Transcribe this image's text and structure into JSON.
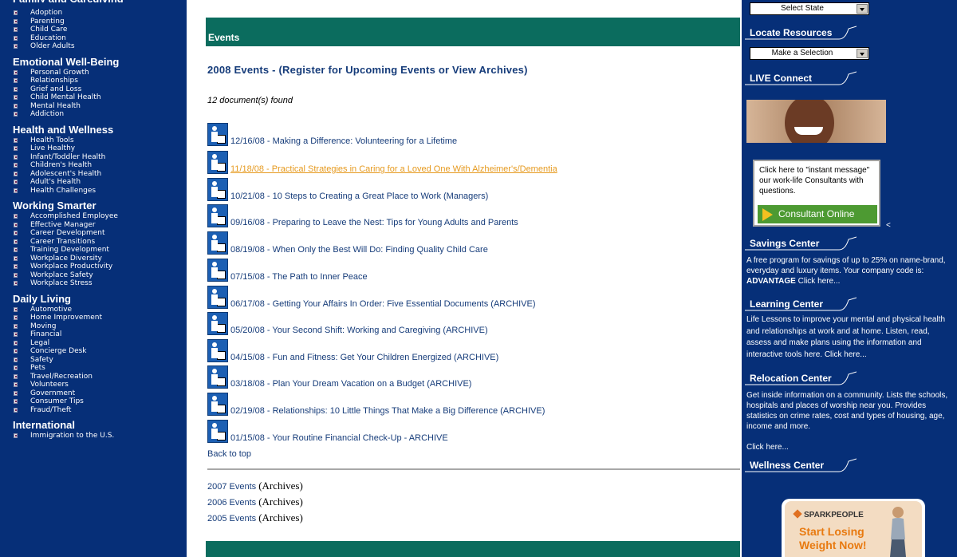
{
  "left_nav": {
    "sections": [
      {
        "title": "Family and Caregiving",
        "items": [
          "Adoption",
          "Parenting",
          "Child Care",
          "Education",
          "Older Adults"
        ]
      },
      {
        "title": "Emotional Well-Being",
        "items": [
          "Personal Growth",
          "Relationships",
          "Grief and Loss",
          "Child Mental Health",
          "Mental Health",
          "Addiction"
        ]
      },
      {
        "title": "Health and Wellness",
        "items": [
          "Health Tools",
          "Live Healthy",
          "Infant/Toddler Health",
          "Children's Health",
          "Adolescent's Health",
          "Adult's Health",
          "Health Challenges"
        ]
      },
      {
        "title": "Working Smarter",
        "items": [
          "Accomplished Employee",
          "Effective Manager",
          "Career Development",
          "Career Transitions",
          "Training Development",
          "Workplace Diversity",
          "Workplace Productivity",
          "Workplace Safety",
          "Workplace Stress"
        ]
      },
      {
        "title": "Daily Living",
        "items": [
          "Automotive",
          "Home Improvement",
          "Moving",
          "Financial",
          "Legal",
          "Concierge Desk",
          "Safety",
          "Pets",
          "Travel/Recreation",
          "Volunteers",
          "Government",
          "Consumer Tips",
          "Fraud/Theft"
        ]
      },
      {
        "title": "International",
        "items": [
          "Immigration to the U.S."
        ]
      }
    ]
  },
  "main": {
    "header": "Events",
    "year_title": "2008 Events - (Register for Upcoming Events or View Archives)",
    "doc_count": "12 document(s) found",
    "events": [
      "12/16/08 - Making a Difference: Volunteering for a Lifetime",
      "11/18/08 - Practical Strategies in Caring for a Loved One With Alzheimer's/Dementia",
      "10/21/08 - 10 Steps to Creating a Great Place to Work (Managers)",
      "09/16/08 - Preparing to Leave the Nest: Tips for Young Adults and Parents",
      "08/19/08 - When Only the Best Will Do: Finding Quality Child Care",
      "07/15/08 - The Path to Inner Peace",
      "06/17/08 - Getting Your Affairs In Order: Five Essential Documents (ARCHIVE)",
      "05/20/08 - Your Second Shift: Working and Caregiving (ARCHIVE)",
      "04/15/08 - Fun and Fitness: Get Your Children Energized (ARCHIVE)",
      "03/18/08 - Plan Your Dream Vacation on a Budget (ARCHIVE)",
      "02/19/08 - Relationships: 10 Little Things That Make a Big Difference (ARCHIVE)",
      "01/15/08 - Your Routine Financial Check-Up - ARCHIVE"
    ],
    "back_to_top": "Back to top",
    "archives": [
      {
        "link": "2007 Events",
        "note": "(Archives)"
      },
      {
        "link": "2006 Events",
        "note": "(Archives)"
      },
      {
        "link": "2005 Events",
        "note": "(Archives)"
      }
    ]
  },
  "right": {
    "state_select": "Select State",
    "locate_title": "Locate Resources",
    "locate_select": "Make a Selection",
    "live_title": "LIVE Connect",
    "im_text": "Click here to \"instant message\" our work-life Consultants with questions.",
    "consultant_btn": "Consultant Online",
    "lt_mark": "<",
    "savings_title": "Savings Center",
    "savings_text_1": "A free program for savings of up to 25% on name-brand, everyday and luxury items. Your company code is:",
    "savings_code": "ADVANTAGE",
    "savings_text_2": "Click here...",
    "learning_title": "Learning Center",
    "learning_text": "Life Lessons to improve your mental and physical health and relationships at work and at home. Listen, read, assess and make plans using the information and interactive tools here.  Click here...",
    "relocation_title": "Relocation Center",
    "relocation_text": "Get inside information on a community. Lists the schools, hospitals and places of worship near you. Provides statistics on crime rates, cost and types of housing, age, income and more.",
    "relocation_click": "Click here...",
    "wellness_title": "Wellness Center",
    "spark_logo": "SPARKPEOPLE",
    "spark_line1": "Start Losing",
    "spark_line2": "Weight Now!"
  },
  "colors": {
    "sidebar_bg": "#062f78",
    "header_bar": "#0b6c5e",
    "link": "#163c7a",
    "highlight_link": "#e69a1f"
  }
}
